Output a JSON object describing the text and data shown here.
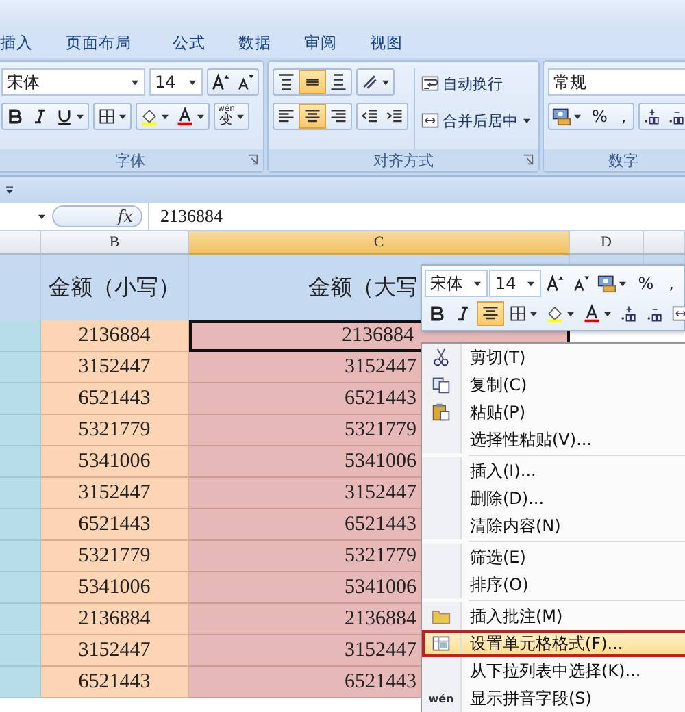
{
  "ribbon_tabs": [
    {
      "label": "插入"
    },
    {
      "label": "页面布局"
    },
    {
      "label": "公式"
    },
    {
      "label": "数据"
    },
    {
      "label": "审阅"
    },
    {
      "label": "视图"
    }
  ],
  "font_group": {
    "font_name": "宋体",
    "font_size": "14",
    "caption": "字体",
    "phonetic_top": "wén",
    "phonetic_glyph": "变"
  },
  "alignment_group": {
    "caption": "对齐方式",
    "vertical": [
      {
        "selected": false
      },
      {
        "selected": true
      },
      {
        "selected": false
      }
    ],
    "horizontal": [
      {
        "selected": false
      },
      {
        "selected": true
      },
      {
        "selected": false
      }
    ],
    "wrap_text": "自动换行",
    "merge_center": "合并后居中"
  },
  "number_group": {
    "format": "常规",
    "caption": "数字",
    "percent": "%",
    "comma": ","
  },
  "formula_bar": {
    "fx": "fx",
    "value": "2136884"
  },
  "columns": [
    {
      "label": "B",
      "selected": false
    },
    {
      "label": "C",
      "selected": true
    },
    {
      "label": "D",
      "selected": false
    }
  ],
  "headers": [
    "金额（小写）",
    "金额（大写"
  ],
  "rows": [
    {
      "b": "2136884",
      "c": "2136884",
      "selected": true
    },
    {
      "b": "3152447",
      "c": "3152447",
      "selected": false
    },
    {
      "b": "6521443",
      "c": "6521443",
      "selected": false
    },
    {
      "b": "5321779",
      "c": "5321779",
      "selected": false
    },
    {
      "b": "5341006",
      "c": "5341006",
      "selected": false
    },
    {
      "b": "3152447",
      "c": "3152447",
      "selected": false
    },
    {
      "b": "6521443",
      "c": "6521443",
      "selected": false
    },
    {
      "b": "5321779",
      "c": "5321779",
      "selected": false
    },
    {
      "b": "5341006",
      "c": "5341006",
      "selected": false
    },
    {
      "b": "2136884",
      "c": "2136884",
      "selected": false
    },
    {
      "b": "3152447",
      "c": "3152447",
      "selected": false
    },
    {
      "b": "6521443",
      "c": "6521443",
      "selected": false
    }
  ],
  "mini_toolbar": {
    "font_name": "宋体",
    "font_size": "14",
    "percent": "%",
    "comma": ",",
    "center_selected": true
  },
  "context_menu": [
    {
      "kind": "item",
      "label": "剪切(T)"
    },
    {
      "kind": "item",
      "label": "复制(C)"
    },
    {
      "kind": "item",
      "label": "粘贴(P)"
    },
    {
      "kind": "item",
      "label": "选择性粘贴(V)..."
    },
    {
      "kind": "separator"
    },
    {
      "kind": "item",
      "label": "插入(I)..."
    },
    {
      "kind": "item",
      "label": "删除(D)..."
    },
    {
      "kind": "item",
      "label": "清除内容(N)"
    },
    {
      "kind": "separator"
    },
    {
      "kind": "item",
      "label": "筛选(E)"
    },
    {
      "kind": "item",
      "label": "排序(O)"
    },
    {
      "kind": "separator"
    },
    {
      "kind": "item",
      "label": "插入批注(M)"
    },
    {
      "kind": "item",
      "label": "设置单元格格式(F)...",
      "highlighted": true
    },
    {
      "kind": "item",
      "label": "从下拉列表中选择(K)..."
    },
    {
      "kind": "item",
      "label": "显示拼音字段(S)",
      "icon_text": "wén"
    }
  ]
}
